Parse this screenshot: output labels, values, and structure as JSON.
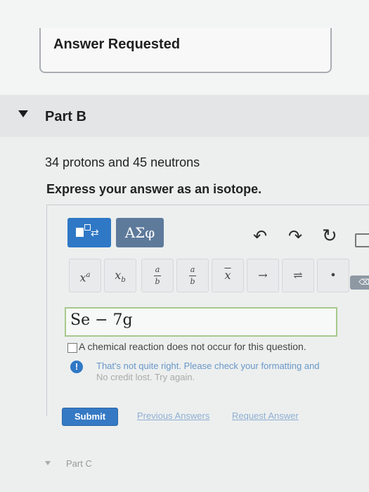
{
  "answer_card": {
    "title": "Answer Requested"
  },
  "part_b": {
    "label": "Part B"
  },
  "question": {
    "text": "34 protons and 45 neutrons",
    "instruction": "Express your answer as an isotope."
  },
  "toolbar": {
    "greek_label": "ΑΣφ",
    "undo_symbol": "↶",
    "redo_symbol": "↷",
    "reset_symbol": "↻",
    "arrow_symbol": "→",
    "equilibrium_symbol": "⇌",
    "dot_symbol": "•",
    "delete_label": "⌫"
  },
  "answer": {
    "value": "Se − 7g"
  },
  "no_reaction_checkbox": {
    "label": "A chemical reaction does not occur for this question.",
    "checked": false
  },
  "feedback": {
    "line1": "That's not quite right. Please check your formatting and",
    "line2": "No credit lost. Try again."
  },
  "actions": {
    "submit_label": "Submit",
    "previous_answers_label": "Previous Answers",
    "request_answer_label": "Request Answer"
  },
  "part_c": {
    "label": "Part C"
  },
  "colors": {
    "accent": "#2f78c6",
    "greek_button": "#5e7a9b",
    "feedback": "#6a97c9"
  }
}
